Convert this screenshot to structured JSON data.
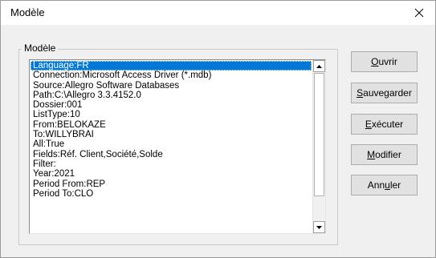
{
  "window": {
    "title": "Modèle",
    "close_glyph": "✕"
  },
  "group": {
    "label": "Modèle"
  },
  "list": {
    "selected_index": 0,
    "items": [
      "Language:FR",
      "Connection:Microsoft Access Driver (*.mdb)",
      "Source:Allegro Software Databases",
      "Path:C:\\Allegro 3.3.4152.0",
      "Dossier:001",
      "ListType:10",
      "From:BELOKAZE",
      "To:WILLYBRAI",
      "All:True",
      "Fields:Réf. Client,Société,Solde",
      "Filter:",
      "Year:2021",
      "Period From:REP",
      "Period To:CLO"
    ]
  },
  "buttons": [
    {
      "id": "open-button",
      "pre": "",
      "key": "O",
      "post": "uvrir"
    },
    {
      "id": "save-button",
      "pre": "",
      "key": "S",
      "post": "auvegarder"
    },
    {
      "id": "execute-button",
      "pre": "",
      "key": "E",
      "post": "xécuter"
    },
    {
      "id": "modify-button",
      "pre": "",
      "key": "M",
      "post": "odifier"
    },
    {
      "id": "cancel-button",
      "pre": "Ann",
      "key": "u",
      "post": "ler"
    }
  ],
  "colors": {
    "selection": "#0078d7",
    "dialog_bg": "#f0f0f0",
    "button_bg": "#e1e1e1"
  }
}
